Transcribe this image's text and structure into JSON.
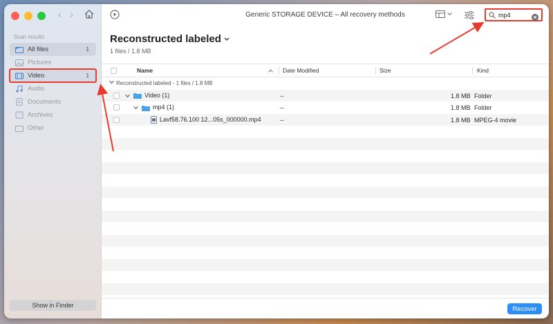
{
  "window": {
    "title": "Generic STORAGE DEVICE – All recovery methods"
  },
  "sidebar": {
    "heading": "Scan results",
    "items": [
      {
        "label": "All files",
        "count": "1",
        "icon": "folder-icon"
      },
      {
        "label": "Pictures",
        "count": "",
        "icon": "picture-icon"
      },
      {
        "label": "Video",
        "count": "1",
        "icon": "video-icon"
      },
      {
        "label": "Audio",
        "count": "",
        "icon": "music-note-icon"
      },
      {
        "label": "Documents",
        "count": "",
        "icon": "document-icon"
      },
      {
        "label": "Archives",
        "count": "",
        "icon": "archive-icon"
      },
      {
        "label": "Other",
        "count": "",
        "icon": "folder-icon"
      }
    ],
    "show_in_finder": "Show in Finder"
  },
  "search": {
    "value": "mp4"
  },
  "main": {
    "title": "Reconstructed labeled",
    "subtitle": "1 files / 1.8 MB"
  },
  "table": {
    "columns": {
      "name": "Name",
      "date": "Date Modified",
      "size": "Size",
      "kind": "Kind"
    },
    "group": "Reconstructed labeled - 1 files / 1.8 MB",
    "rows": [
      {
        "name": "Video (1)",
        "date": "--",
        "size": "1.8 MB",
        "kind": "Folder"
      },
      {
        "name": "mp4 (1)",
        "date": "--",
        "size": "1.8 MB",
        "kind": "Folder"
      },
      {
        "name": "Lavf58.76.100 12...05s_000000.mp4",
        "date": "--",
        "size": "1.8 MB",
        "kind": "MPEG-4 movie"
      }
    ]
  },
  "footer": {
    "recover_label": "Recover"
  },
  "colors": {
    "accent": "#2f8ef5",
    "highlight": "#e63b2e",
    "folder": "#4aa3e8"
  }
}
